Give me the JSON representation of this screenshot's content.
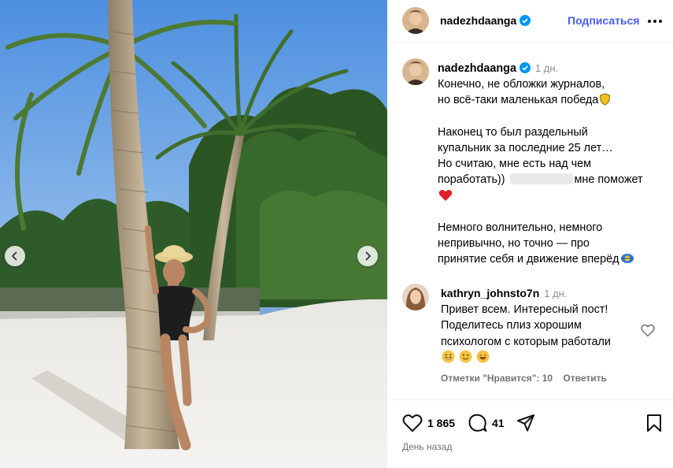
{
  "post": {
    "author": "nadezhdaanga",
    "follow_label": "Подписаться",
    "time": "1 дн.",
    "caption_lines": [
      "Конечно, не обложки журналов,",
      "но всё-таки маленькая победа",
      "Наконец то был раздельный",
      "купальник за последние 25 лет…",
      "Но считаю, мне есть над чем",
      "поработать))",
      "мне поможет",
      "Немного волнительно, немного",
      "непривычно, но точно — про",
      "принятие себя и движение вперёд"
    ]
  },
  "comment": {
    "author": "kathryn_johnsto7n",
    "time": "1 дн.",
    "lines": [
      "Привет всем. Интересный пост!",
      "Поделитесь плиз хорошим",
      "психологом с которым работали"
    ],
    "likes_label": "Отметки \"Нравится\": 10",
    "reply_label": "Ответить"
  },
  "actions": {
    "likes_count": "1 865",
    "comments_count": "41",
    "date": "День назад"
  },
  "icons": {
    "verified": "verified-badge-icon",
    "more": "more-options-icon",
    "like": "heart-icon",
    "comment": "comment-icon",
    "share": "share-icon",
    "save": "bookmark-icon",
    "nav": "chevron-icon"
  },
  "colors": {
    "accent": "#4a5df9",
    "verified": "#0095f6",
    "muted": "#737373"
  }
}
